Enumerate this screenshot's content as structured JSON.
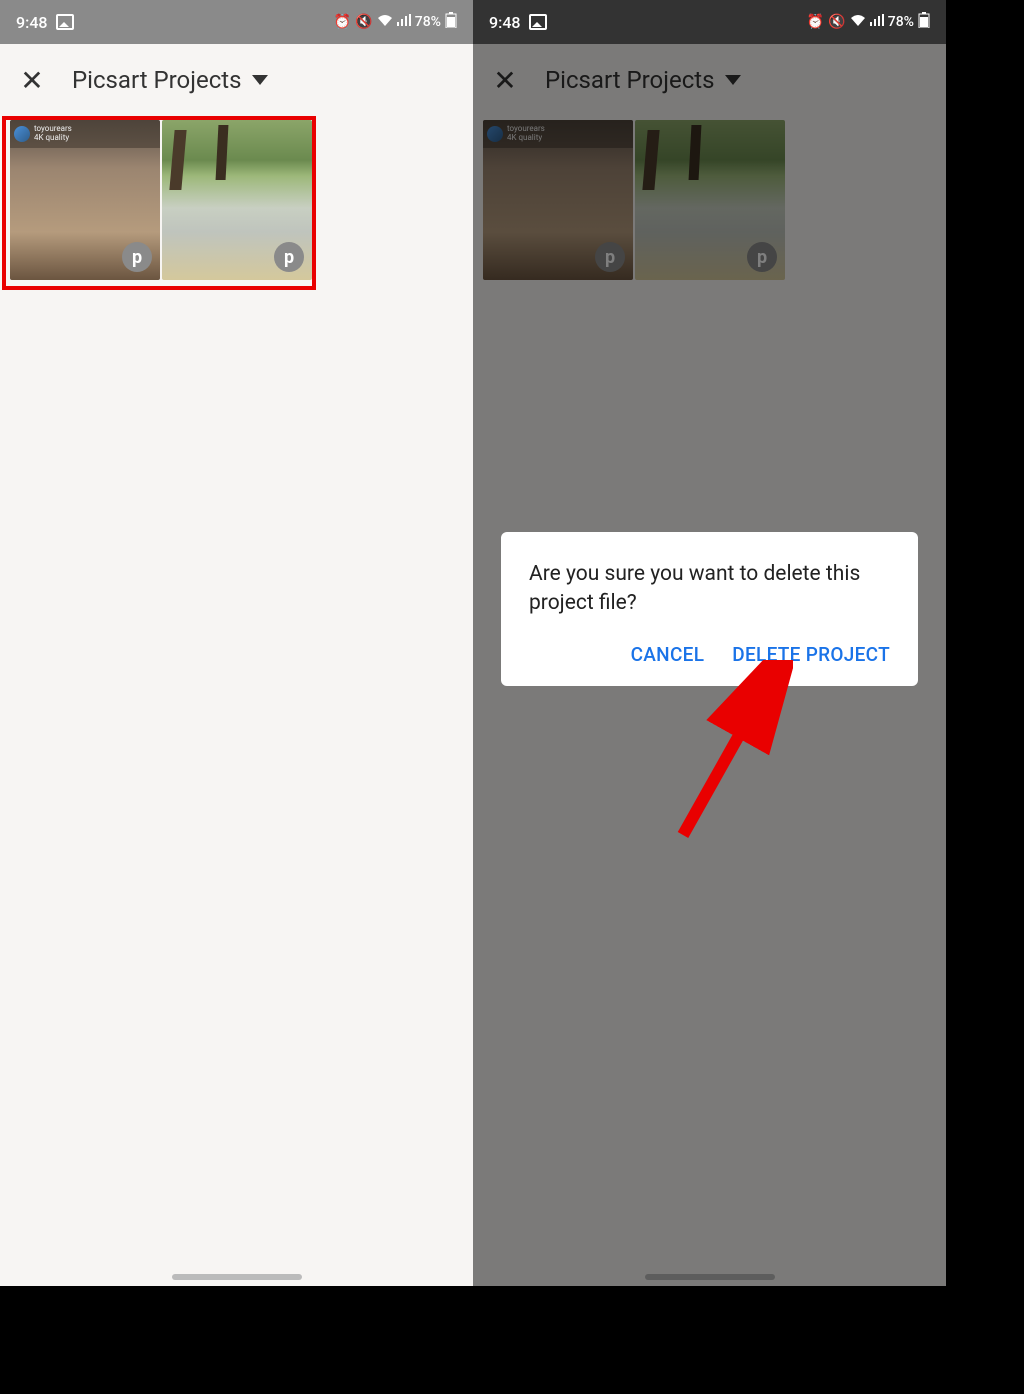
{
  "status": {
    "time": "9:48",
    "battery": "78%"
  },
  "header": {
    "title": "Picsart Projects"
  },
  "thumb1": {
    "username": "toyourears",
    "meta": "4K quality"
  },
  "dialog": {
    "message": "Are you sure you want to delete this project file?",
    "cancel": "CANCEL",
    "delete": "DELETE PROJECT"
  }
}
